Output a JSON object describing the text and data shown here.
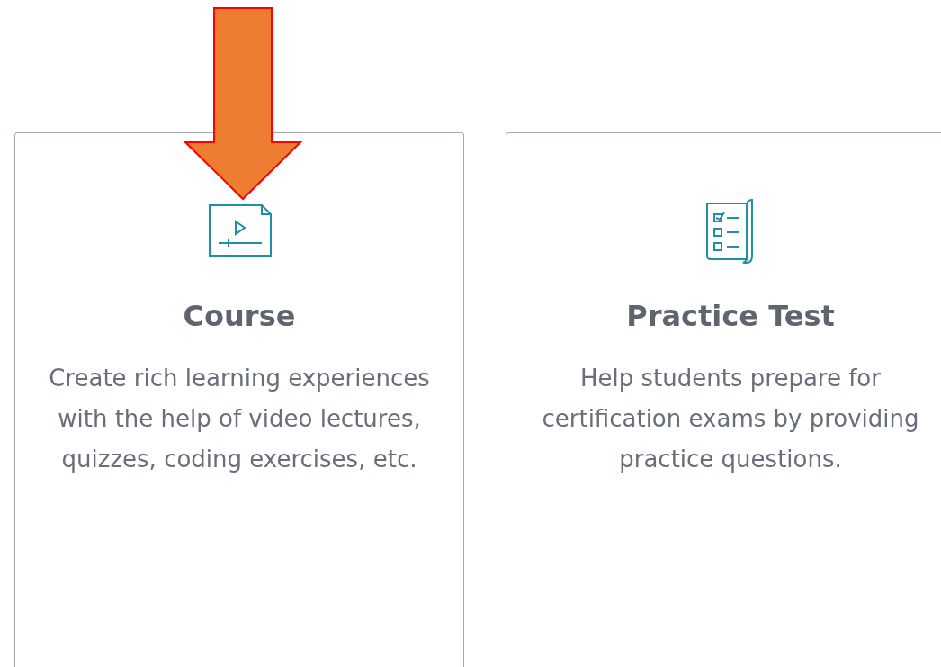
{
  "cards": [
    {
      "kind": "course",
      "title": "Course",
      "description": "Create rich learning experiences with the help of video lectures, quizzes, coding exercises, etc."
    },
    {
      "kind": "practice_test",
      "title": "Practice Test",
      "description": "Help students prepare for certification exams by providing practice questions."
    }
  ]
}
